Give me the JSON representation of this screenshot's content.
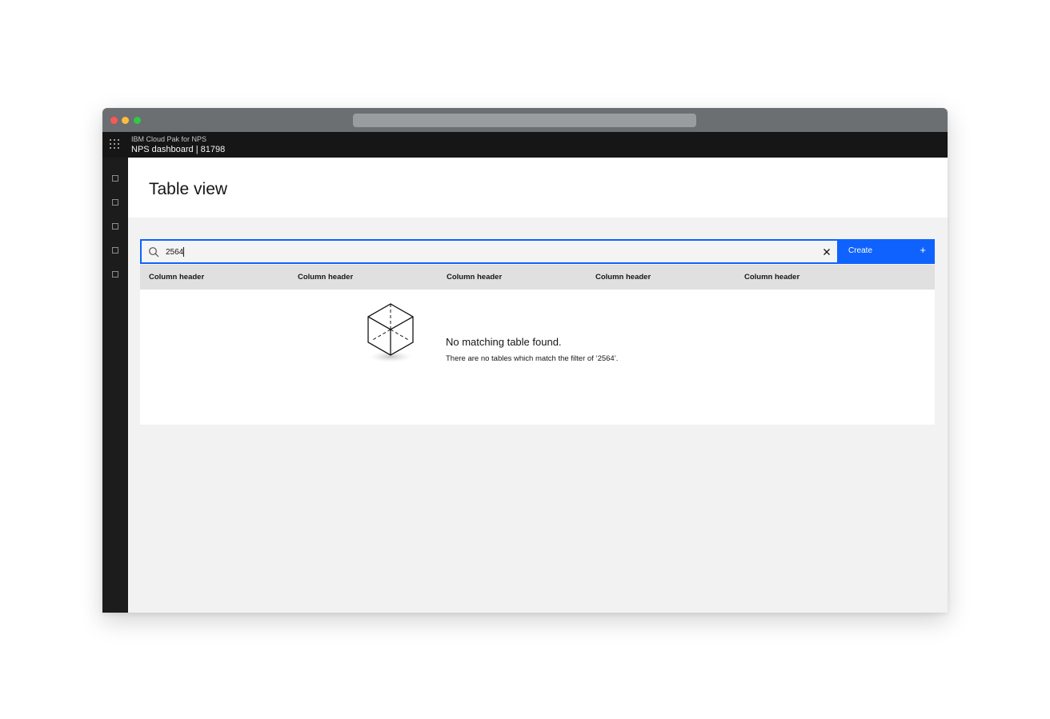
{
  "header": {
    "app_subtitle": "IBM Cloud Pak for NPS",
    "app_title": "NPS dashboard | 81798"
  },
  "sidenav": {
    "items": [
      "nav-item",
      "nav-item",
      "nav-item",
      "nav-item",
      "nav-item"
    ]
  },
  "page": {
    "title": "Table view"
  },
  "toolbar": {
    "search_value": "2564",
    "create_label": "Create",
    "create_icon": "+"
  },
  "table": {
    "columns": [
      "Column header",
      "Column header",
      "Column header",
      "Column header",
      "Column header"
    ]
  },
  "empty_state": {
    "title": "No matching table found.",
    "message": "There are no tables which match the filter of ‘2564’."
  },
  "colors": {
    "primary": "#0f62fe",
    "header_bg": "#161616",
    "titlebar_bg": "#6b6f72",
    "page_bg": "#f2f2f2"
  }
}
